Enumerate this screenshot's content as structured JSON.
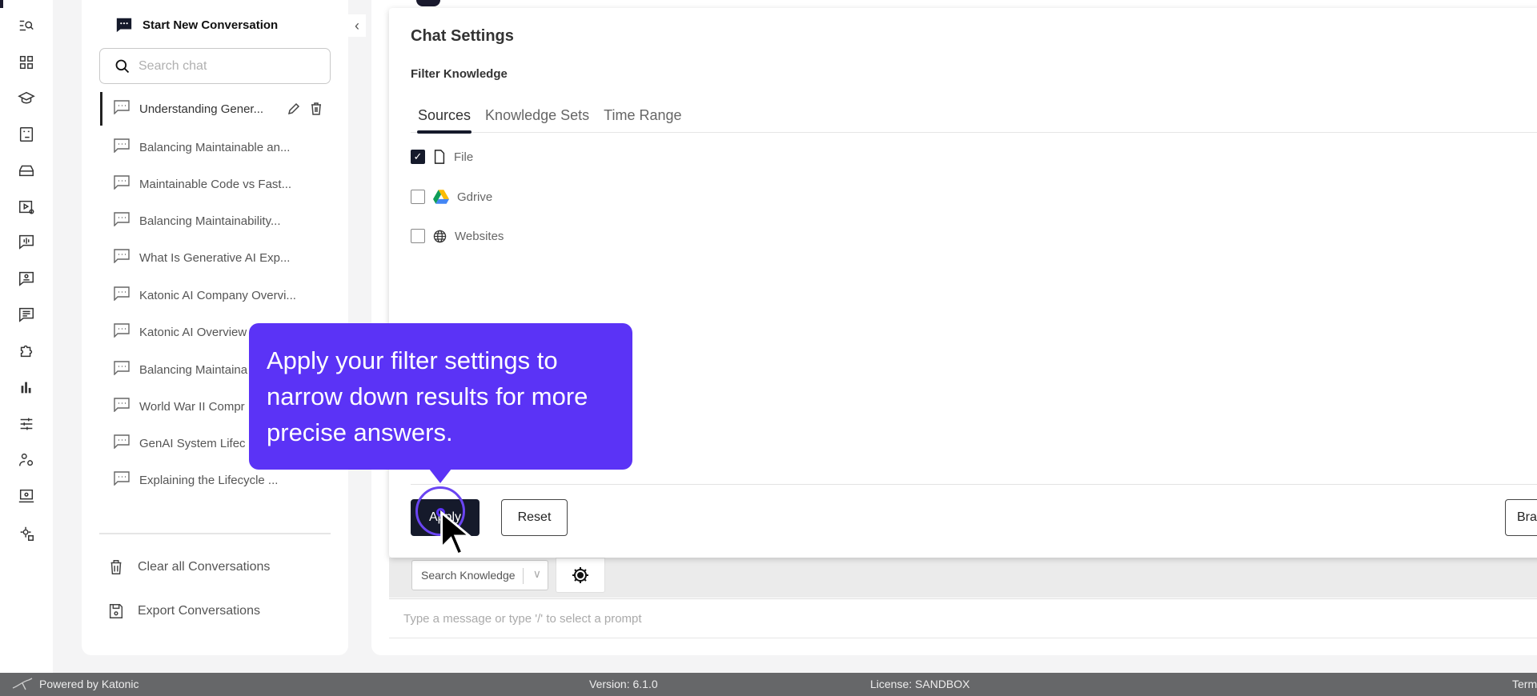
{
  "rail": {
    "icons": [
      "search-list-icon",
      "grid-icon",
      "graduation-cap-icon",
      "dashboard-link-icon",
      "toolbox-icon",
      "video-settings-icon",
      "voice-chat-icon",
      "contact-chat-icon",
      "list-chat-icon",
      "puzzle-icon",
      "bar-chart-icon",
      "sliders-icon",
      "user-settings-icon",
      "laptop-search-icon",
      "gear-user-icon"
    ]
  },
  "sidebar": {
    "new_conversation": "Start New Conversation",
    "search_placeholder": "Search chat",
    "conversations": [
      "Understanding Gener...",
      "Balancing Maintainable an...",
      "Maintainable Code vs Fast...",
      "Balancing Maintainability...",
      "What Is Generative AI Exp...",
      "Katonic AI Company Overvi...",
      "Katonic AI Overview",
      "Balancing Maintaina",
      "World War II Compr",
      "GenAI System Lifec",
      "Explaining the Lifecycle ..."
    ],
    "clear_all": "Clear all Conversations",
    "export": "Export Conversations"
  },
  "modal": {
    "title": "Chat Settings",
    "subtitle": "Filter Knowledge",
    "tabs": [
      "Sources",
      "Knowledge Sets",
      "Time Range"
    ],
    "active_tab": "Sources",
    "sources": [
      {
        "label": "File",
        "checked": true
      },
      {
        "label": "Gdrive",
        "checked": false
      },
      {
        "label": "Websites",
        "checked": false
      }
    ],
    "apply": "Apply",
    "reset": "Reset",
    "brand": "Bran"
  },
  "composer": {
    "knowledge_select": "Search Knowledge",
    "message_placeholder": "Type a message or type '/' to select a prompt"
  },
  "tooltip": {
    "text": "Apply your filter settings to narrow down results for more precise answers.",
    "color": "#5b33f6"
  },
  "footer": {
    "powered": "Powered by Katonic",
    "version": "Version: 6.1.0",
    "license": "License: SANDBOX",
    "terms": "Term"
  }
}
